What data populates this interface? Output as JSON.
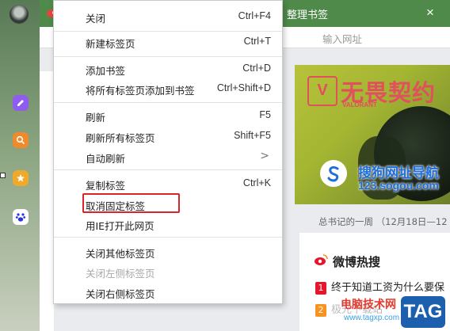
{
  "browser": {
    "tab_title": "整理书签",
    "address_placeholder": "输入网址"
  },
  "menu": {
    "items": [
      {
        "label": "关闭",
        "shortcut": "Ctrl+F4"
      },
      {
        "label": "新建标签页",
        "shortcut": "Ctrl+T"
      },
      {
        "label": "添加书签",
        "shortcut": "Ctrl+D"
      },
      {
        "label": "将所有标签页添加到书签",
        "shortcut": "Ctrl+Shift+D"
      },
      {
        "label": "刷新",
        "shortcut": "F5"
      },
      {
        "label": "刷新所有标签页",
        "shortcut": "Shift+F5"
      },
      {
        "label": "自动刷新",
        "shortcut": ">"
      },
      {
        "label": "复制标签",
        "shortcut": "Ctrl+K"
      },
      {
        "label": "取消固定标签",
        "shortcut": ""
      },
      {
        "label": "用IE打开此网页",
        "shortcut": ""
      },
      {
        "label": "关闭其他标签页",
        "shortcut": ""
      },
      {
        "label": "关闭左侧标签页",
        "shortcut": ""
      },
      {
        "label": "关闭右侧标签页",
        "shortcut": ""
      }
    ]
  },
  "page": {
    "banner_promo": "无畏契约",
    "banner_brand": "VALORANT",
    "sogou_name": "搜狗网址导航",
    "sogou_url": "123.sogou.com",
    "summary": "总书记的一周 （12月18日—12",
    "hot_title": "微博热搜",
    "hot_items": [
      {
        "rank": "1",
        "text": "终于知道工资为什么要保"
      },
      {
        "rank": "2",
        "text": "极光下载站"
      }
    ]
  },
  "watermark": {
    "text": "电脑技术网",
    "url": "www.tagxp.com",
    "tag": "TAG"
  },
  "colors": {
    "highlight": "#d9232d",
    "chrome": "#4f8a4a",
    "sogou_blue": "#1e6fd9"
  }
}
